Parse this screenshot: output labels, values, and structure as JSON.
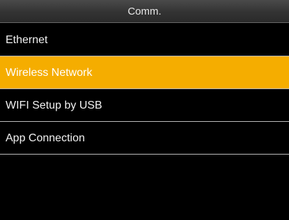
{
  "title_bar": {
    "title": "Comm."
  },
  "menu": {
    "items": [
      {
        "label": "Ethernet",
        "selected": false
      },
      {
        "label": "Wireless Network",
        "selected": true
      },
      {
        "label": "WIFI Setup by USB",
        "selected": false
      },
      {
        "label": "App Connection",
        "selected": false
      }
    ]
  },
  "colors": {
    "background": "#000000",
    "selection_highlight": "#f5ad00",
    "text": "#f2f2f2",
    "divider": "#bdbdbd"
  }
}
